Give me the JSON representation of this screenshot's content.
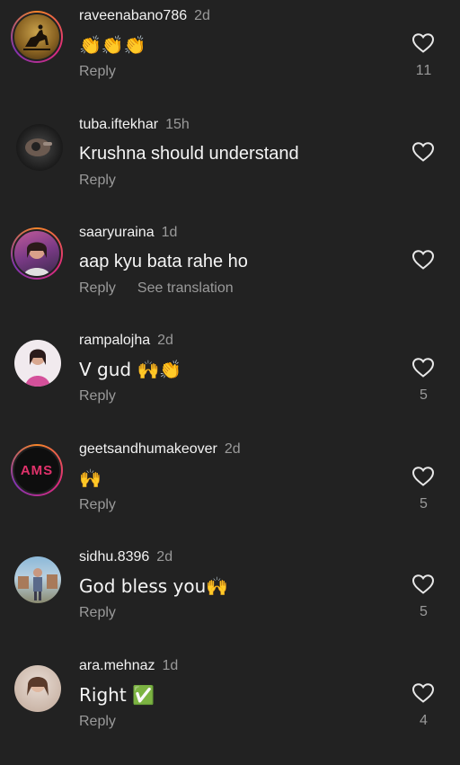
{
  "comments": [
    {
      "username": "raveenabano786",
      "time": "2d",
      "text": "👏👏👏",
      "reply_label": "Reply",
      "translation_label": "",
      "likes": "11",
      "avatar_colors": [
        "#6b4a1c",
        "#c9a24c"
      ]
    },
    {
      "username": "tuba.iftekhar",
      "time": "15h",
      "text": "Krushna should understand",
      "reply_label": "Reply",
      "translation_label": "",
      "likes": "",
      "avatar_colors": [
        "#151515",
        "#5d5d5d"
      ]
    },
    {
      "username": "saaryuraina",
      "time": "1d",
      "text": "aap kyu bata rahe ho",
      "reply_label": "Reply",
      "translation_label": "See translation",
      "likes": "",
      "avatar_colors": [
        "#7a3a86",
        "#e08bb8"
      ]
    },
    {
      "username": "rampalojha",
      "time": "2d",
      "text": "V gud 🙌👏",
      "reply_label": "Reply",
      "translation_label": "",
      "likes": "5",
      "avatar_colors": [
        "#f3eaf0",
        "#d4509a"
      ]
    },
    {
      "username": "geetsandhumakeover",
      "time": "2d",
      "text": "🙌",
      "reply_label": "Reply",
      "translation_label": "",
      "likes": "5",
      "avatar_colors": [
        "#0e0e0e",
        "#e0326b"
      ],
      "avatar_text": "AMS"
    },
    {
      "username": "sidhu.8396",
      "time": "2d",
      "text": "God bless you🙌",
      "reply_label": "Reply",
      "translation_label": "",
      "likes": "5",
      "avatar_colors": [
        "#8cb8d8",
        "#6a6a5a"
      ]
    },
    {
      "username": "ara.mehnaz",
      "time": "1d",
      "text": "Right ✅",
      "reply_label": "Reply",
      "translation_label": "",
      "likes": "4",
      "avatar_colors": [
        "#d9c5b8",
        "#8a6a5a"
      ]
    }
  ],
  "colors": {
    "background": "#222222",
    "primary_text": "#f2f2f2",
    "secondary_text": "#9a9a9a",
    "story_ring": "#dd2a7b"
  }
}
